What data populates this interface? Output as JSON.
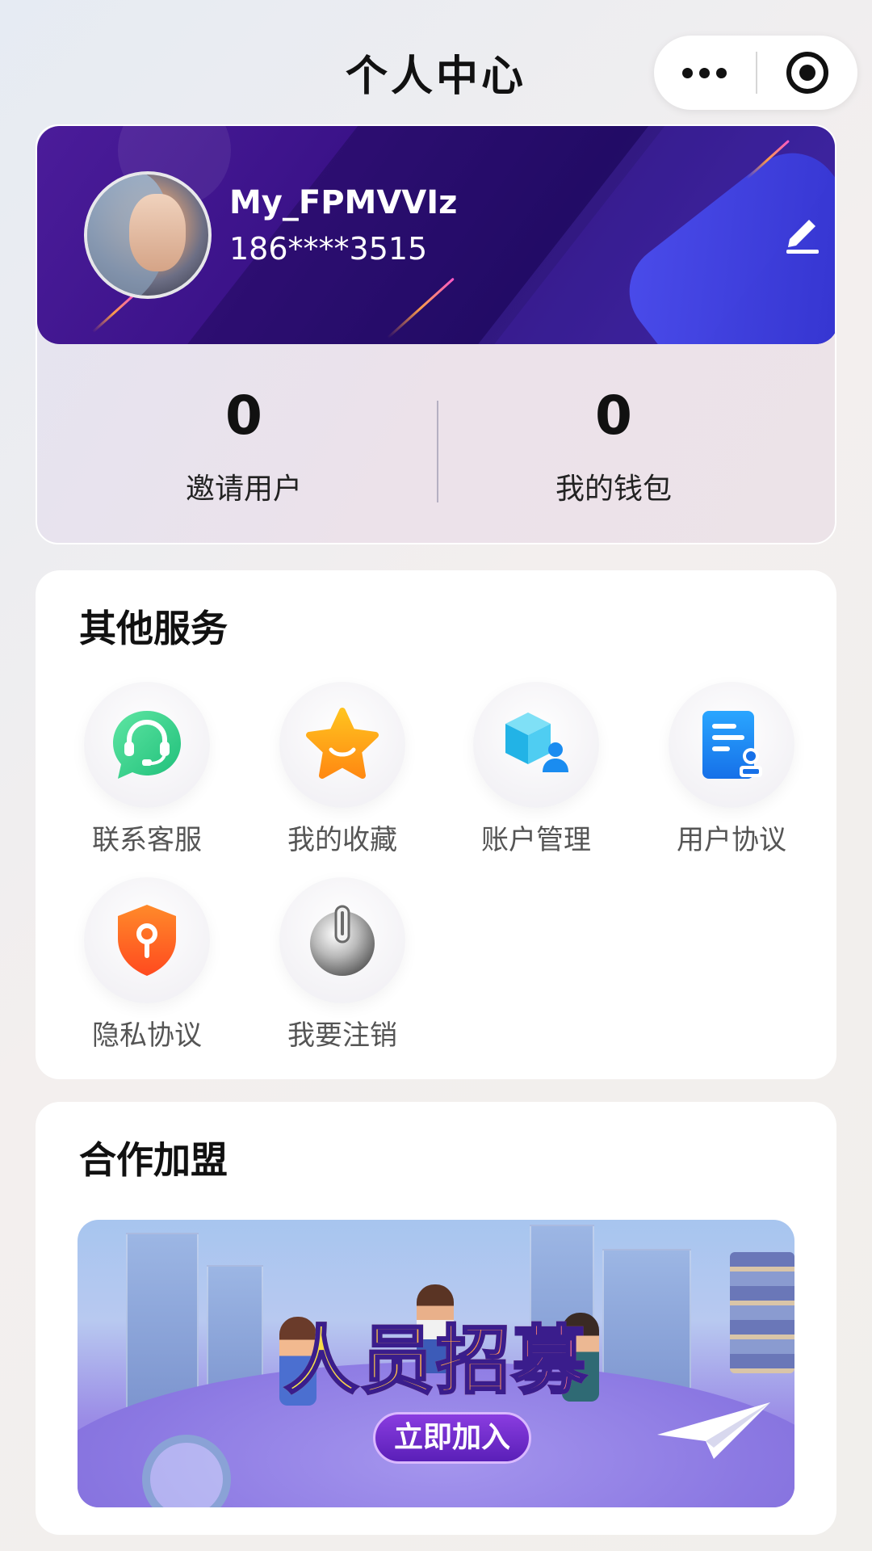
{
  "header": {
    "title": "个人中心",
    "capsule": {
      "more_icon": "more-dots-icon",
      "close_icon": "target-close-icon"
    }
  },
  "profile": {
    "username": "My_FPMVVIz",
    "phone": "186****3515",
    "edit_icon": "pencil-icon",
    "stats": [
      {
        "value": "0",
        "label": "邀请用户"
      },
      {
        "value": "0",
        "label": "我的钱包"
      }
    ]
  },
  "services": {
    "title": "其他服务",
    "items": [
      {
        "label": "联系客服",
        "icon": "headset-chat-icon",
        "color": "#3fd38f"
      },
      {
        "label": "我的收藏",
        "icon": "star-icon",
        "color": "#ffa21a"
      },
      {
        "label": "账户管理",
        "icon": "account-cube-icon",
        "color": "#2fc0ec"
      },
      {
        "label": "用户协议",
        "icon": "document-stamp-icon",
        "color": "#1f8cf5"
      },
      {
        "label": "隐私协议",
        "icon": "shield-lock-icon",
        "color": "#ff6a2a"
      },
      {
        "label": "我要注销",
        "icon": "power-icon",
        "color": "#8c8c8c"
      }
    ]
  },
  "partner": {
    "title": "合作加盟",
    "banner": {
      "headline": "人员招募",
      "button": "立即加入"
    }
  },
  "colors": {
    "banner_primary": "#3a1288",
    "banner_accent": "#4c4ff0",
    "card_background": "#ffffff"
  }
}
